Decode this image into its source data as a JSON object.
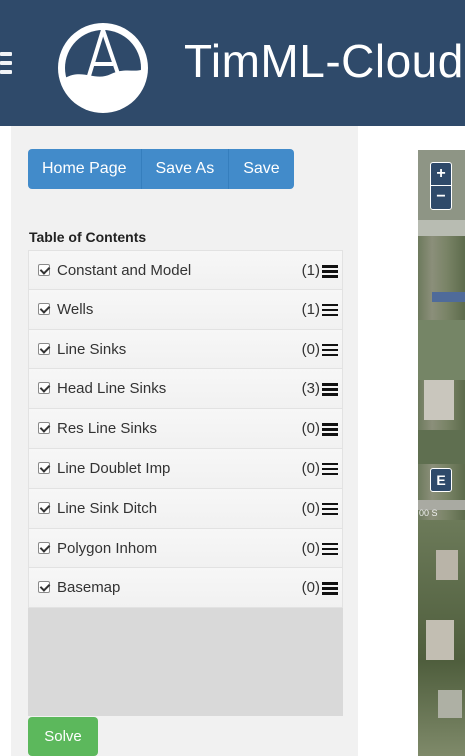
{
  "header": {
    "app_title": "TimML-Cloud"
  },
  "toolbar": {
    "buttons": [
      {
        "label": "Home Page"
      },
      {
        "label": "Save As"
      },
      {
        "label": "Save"
      }
    ]
  },
  "toc": {
    "title": "Table of Contents",
    "items": [
      {
        "label": "Constant and Model",
        "count": "(1)",
        "checked": true
      },
      {
        "label": "Wells",
        "count": "(1)",
        "checked": true
      },
      {
        "label": "Line Sinks",
        "count": "(0)",
        "checked": true
      },
      {
        "label": "Head Line Sinks",
        "count": "(3)",
        "checked": true
      },
      {
        "label": "Res Line Sinks",
        "count": "(0)",
        "checked": true
      },
      {
        "label": "Line Doublet Imp",
        "count": "(0)",
        "checked": true
      },
      {
        "label": "Line Sink Ditch",
        "count": "(0)",
        "checked": true
      },
      {
        "label": "Polygon Inhom",
        "count": "(0)",
        "checked": true
      },
      {
        "label": "Basemap",
        "count": "(0)",
        "checked": true
      }
    ]
  },
  "actions": {
    "solve_label": "Solve"
  },
  "map": {
    "zoom_in": "+",
    "zoom_out": "−",
    "edit_label": "E",
    "street_text": "00 S"
  },
  "colors": {
    "header_bg": "#2f4a6a",
    "primary_button": "#428bca",
    "success_button": "#5cb85c"
  }
}
